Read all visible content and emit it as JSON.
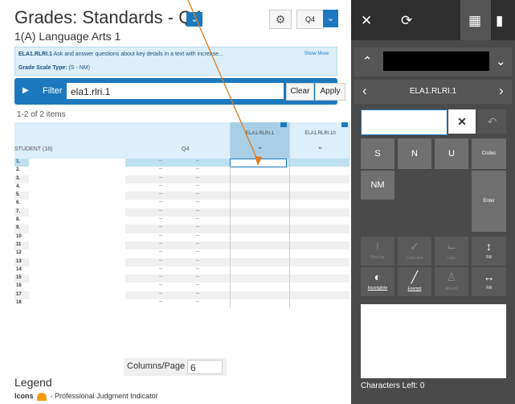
{
  "page": {
    "title": "Grades: Standards - Q4",
    "subtitle": "1(A) Language Arts 1",
    "term": "Q4"
  },
  "standard": {
    "code": "ELA1.RLRI.1",
    "description": " Ask and answer questions about key details in a text with increase...",
    "show_more": "Show More",
    "scale_label": "Grade Scale Type:",
    "scale_value": " (S - NM)"
  },
  "filter": {
    "label": "Filter",
    "value": "ela1.rlri.1",
    "clear": "Clear",
    "apply": "Apply"
  },
  "items_count": "1-2 of 2 items",
  "grid": {
    "student_header": "STUDENT (18)",
    "term_header": "Q4",
    "columns": [
      "ELA1.RLRI.1",
      "ELA1.RLRI.10"
    ],
    "rows": [
      "1.",
      "2.",
      "3.",
      "4.",
      "5.",
      "6.",
      "7.",
      "8.",
      "9.",
      "10",
      "11",
      "12",
      "13",
      "14",
      "15",
      "16",
      "17",
      "18"
    ],
    "dash": "--"
  },
  "columns_per_page": {
    "label": "Columns/Page",
    "value": "6"
  },
  "legend": {
    "title": "Legend",
    "icons_label": "Icons",
    "pji_text": " - Professional Judgment Indicator"
  },
  "panel": {
    "nav_label": "ELA1.RLRI.1",
    "keys": [
      "S",
      "N",
      "U",
      "Codes",
      "NM",
      "Enter"
    ],
    "actions": [
      "Missing",
      "Collected",
      "Late",
      "Fill",
      "Incomplete",
      "Exempt",
      "Absent",
      "Fill"
    ],
    "chars_left": "Characters Left: 0"
  },
  "colors": {
    "accent": "#1c79c0",
    "panel": "#4a4a4a",
    "highlight": "#dceffa",
    "annotation": "#e07a1f"
  }
}
